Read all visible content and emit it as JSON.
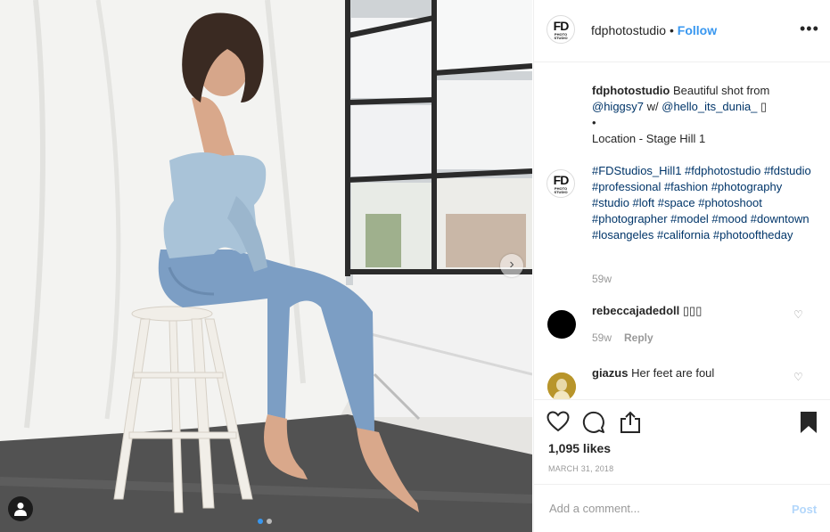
{
  "post": {
    "username": "fdphotostudio",
    "follow_label": "Follow",
    "separator": "•",
    "more_label": "•••",
    "logo_big": "FD",
    "logo_small": "PHOTO STUDIO"
  },
  "caption": {
    "username": "fdphotostudio",
    "text_before": " Beautiful shot from ",
    "mention1": "@higgsy7",
    "text_mid": " w/ ",
    "mention2": "@hello_its_dunia_",
    "emoji": " ▯",
    "bullet": "•",
    "location": "Location - Stage Hill 1",
    "hashtags": "#FDStudios_Hill1 #fdphotostudio #fdstudio #professional #fashion #photography #studio #loft #space #photoshoot #photographer #model #mood #downtown #losangeles #california #photooftheday",
    "time": "59w"
  },
  "comments": [
    {
      "username": "rebeccajadedoll",
      "text": " ▯▯▯",
      "time": "59w",
      "reply_label": "Reply"
    },
    {
      "username": "giazus",
      "text": " Her feet are foul"
    }
  ],
  "icons": {
    "heart": "heart-icon",
    "comment": "comment-icon",
    "share": "share-icon",
    "bookmark": "bookmark-icon",
    "small_heart": "♡"
  },
  "likes_text": "1,095 likes",
  "date_text": "MARCH 31, 2018",
  "add_comment": {
    "placeholder": "Add a comment...",
    "post_label": "Post"
  },
  "carousel": {
    "total": 2,
    "current": 1
  },
  "colors": {
    "link": "#3897f0",
    "hashtag": "#003569",
    "muted": "#999999",
    "post_disabled": "#b3d7fb"
  }
}
